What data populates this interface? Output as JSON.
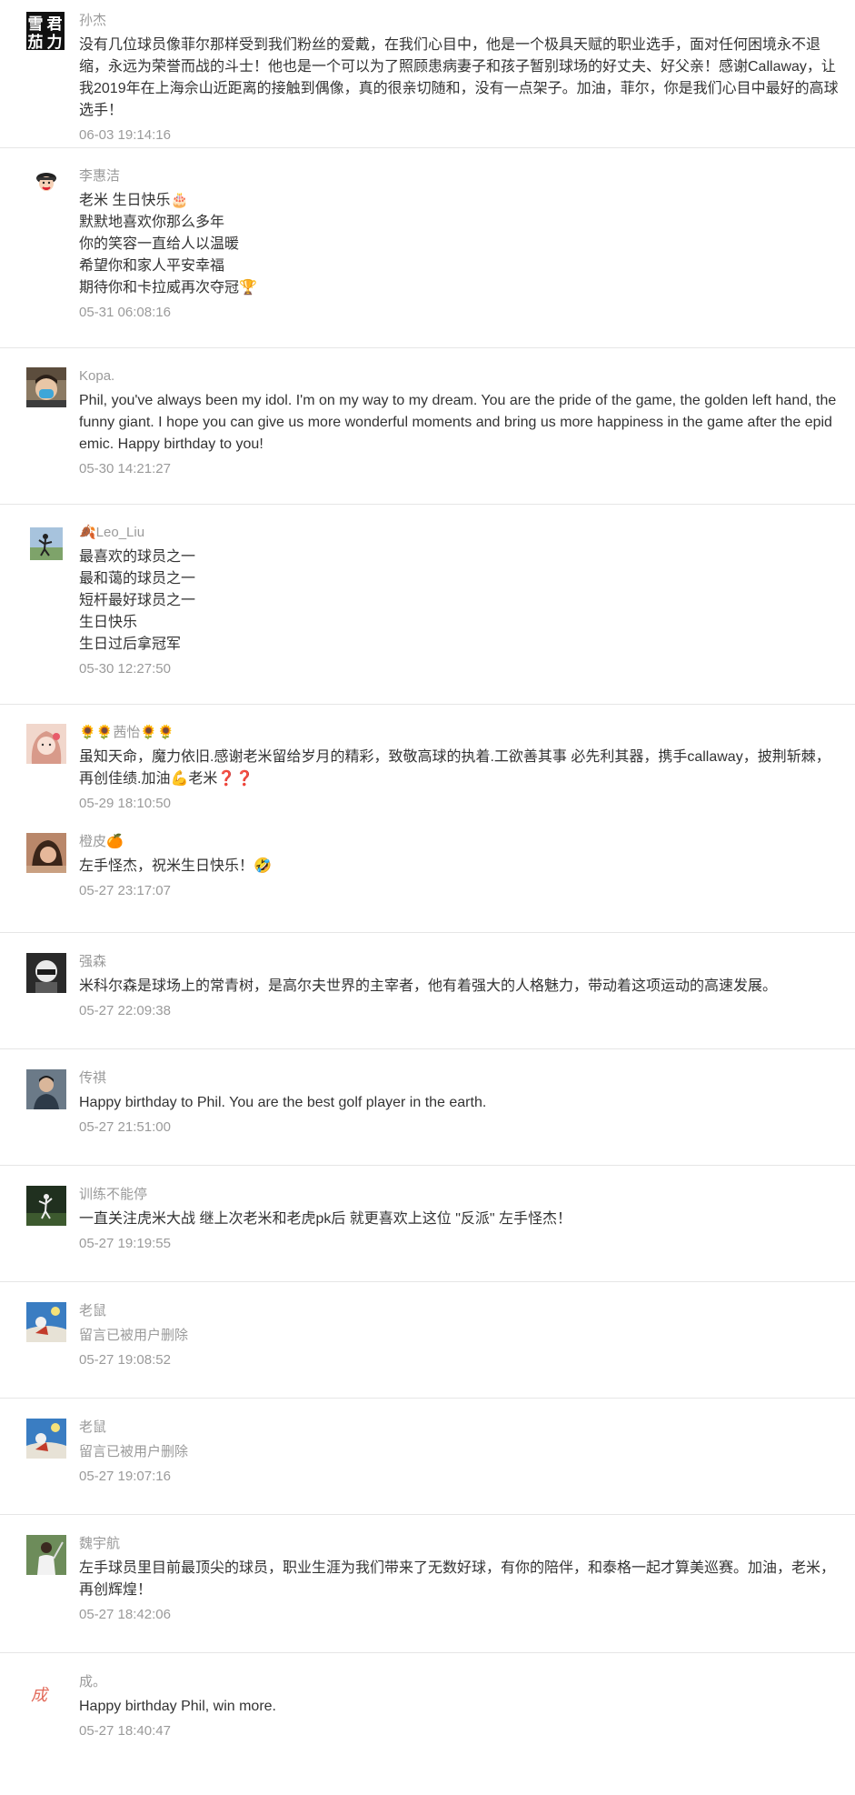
{
  "comments": [
    {
      "nickname": "孙杰",
      "content": [
        "没有几位球员像菲尔那样受到我们粉丝的爱戴，在我们心目中，他是一个极具天赋的职业选手，面对任何困境永不退缩，永远为荣誉而战的斗士！他也是一个可以为了照顾患病妻子和孩子暂别球场的好丈夫、好父亲！感谢Callaway，让我2019年在上海佘山近距离的接触到偶像，真的很亲切随和，没有一点架子。加油，菲尔，你是我们心目中最好的高球选手！"
      ],
      "time": "06-03 19:14:16",
      "avatar_text": "雪君\n茄力",
      "avatar_bg": "#111111"
    },
    {
      "nickname": "李惠洁",
      "content": [
        "老米 生日快乐🎂",
        "默默地喜欢你那么多年",
        "你的笑容一直给人以温暖",
        "希望你和家人平安幸福",
        "期待你和卡拉威再次夺冠🏆"
      ],
      "time": "05-31 06:08:16",
      "avatar_bg": "#ffffff"
    },
    {
      "nickname": "Kopa.",
      "content": [
        "Phil, you've always been my idol. I'm on my way to my dream. You are the pride of the game, the golden left hand, the funny giant. I hope you can give us more wonderful moments and bring us more happiness in the game after the epidemic. Happy birthday to you!"
      ],
      "time": "05-30 14:21:27",
      "avatar_bg": "#7a6a55"
    },
    {
      "nickname": "🍂Leo_Liu",
      "content": [
        "最喜欢的球员之一",
        "最和蔼的球员之一",
        "短杆最好球员之一",
        "生日快乐",
        "生日过后拿冠军"
      ],
      "time": "05-30 12:27:50",
      "avatar_bg": "#a9c4de"
    },
    {
      "nickname": "🌻🌻茜怡🌻🌻",
      "content": [
        "虽知天命，魔力依旧.感谢老米留给岁月的精彩，致敬高球的执着.工欲善其事 必先利其器，携手callaway，披荆斩棘，再创佳绩.加油💪老米❓❓"
      ],
      "time": "05-29 18:10:50",
      "avatar_bg": "#e8b8a8"
    },
    {
      "nickname": "橙皮🍊",
      "content": [
        "左手怪杰，祝米生日快乐！🤣"
      ],
      "time": "05-27 23:17:07",
      "avatar_bg": "#c98b6b"
    },
    {
      "nickname": "强森",
      "content": [
        "米科尔森是球场上的常青树，是高尔夫世界的主宰者，他有着强大的人格魅力，带动着这项运动的高速发展。"
      ],
      "time": "05-27 22:09:38",
      "avatar_bg": "#2a2a2a"
    },
    {
      "nickname": "传祺",
      "content": [
        "Happy birthday to Phil. You are the best  golf player in the earth."
      ],
      "time": "05-27 21:51:00",
      "avatar_bg": "#4d5a6a"
    },
    {
      "nickname": "训练不能停",
      "content": [
        "一直关注虎米大战  继上次老米和老虎pk后 就更喜欢上这位 \"反派\"  左手怪杰！"
      ],
      "time": "05-27 19:19:55",
      "avatar_bg": "#2e3b2a"
    },
    {
      "nickname": "老鼠",
      "content": [
        "留言已被用户删除"
      ],
      "time": "05-27 19:08:52",
      "deleted": true,
      "avatar_bg": "#2d6fb0"
    },
    {
      "nickname": "老鼠",
      "content": [
        "留言已被用户删除"
      ],
      "time": "05-27 19:07:16",
      "deleted": true,
      "avatar_bg": "#2d6fb0"
    },
    {
      "nickname": "魏宇航",
      "content": [
        "左手球员里目前最顶尖的球员，职业生涯为我们带来了无数好球，有你的陪伴，和泰格一起才算美巡赛。加油，老米，再创辉煌！"
      ],
      "time": "05-27 18:42:06",
      "avatar_bg": "#5a7a4a"
    },
    {
      "nickname": "成。",
      "content": [
        "Happy birthday Phil, win more."
      ],
      "time": "05-27 18:40:47",
      "avatar_text": "成",
      "avatar_bg": "#ffffff"
    }
  ]
}
